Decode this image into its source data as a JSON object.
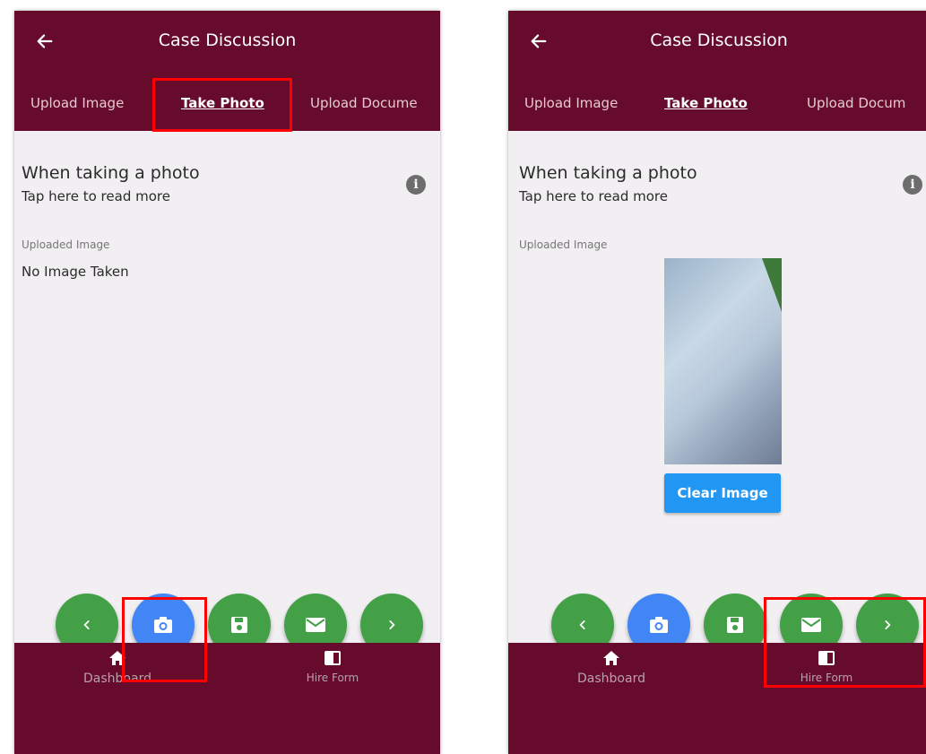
{
  "screens": [
    {
      "title": "Case Discussion",
      "tabs": [
        "Upload Image",
        "Take Photo",
        "Upload Docume"
      ],
      "active_tab": "Take Photo",
      "info_title": "When taking a photo",
      "info_link": "Tap here to read more",
      "uploaded_label": "Uploaded Image",
      "image_status": "No Image Taken",
      "bottom_nav": [
        "Dashboard",
        "Hire Form"
      ]
    },
    {
      "title": "Case Discussion",
      "tabs": [
        "Upload Image",
        "Take Photo",
        "Upload Docum"
      ],
      "active_tab": "Take Photo",
      "info_title": "When taking a photo",
      "info_link": "Tap here to read more",
      "uploaded_label": "Uploaded Image",
      "clear_button": "Clear Image",
      "bottom_nav": [
        "Dashboard",
        "Hire Form"
      ]
    }
  ],
  "colors": {
    "header": "#670b2d",
    "fab_green": "#43a047",
    "fab_blue": "#4285f4",
    "clear_button": "#2196f3",
    "highlight": "#ff0000"
  },
  "icons": {
    "back": "arrow-left-icon",
    "info": "info-icon",
    "prev": "chevron-left-icon",
    "camera": "camera-icon",
    "save": "floppy-icon",
    "mail": "mail-icon",
    "next": "chevron-right-icon",
    "home": "home-icon",
    "hire_form": "form-icon"
  }
}
